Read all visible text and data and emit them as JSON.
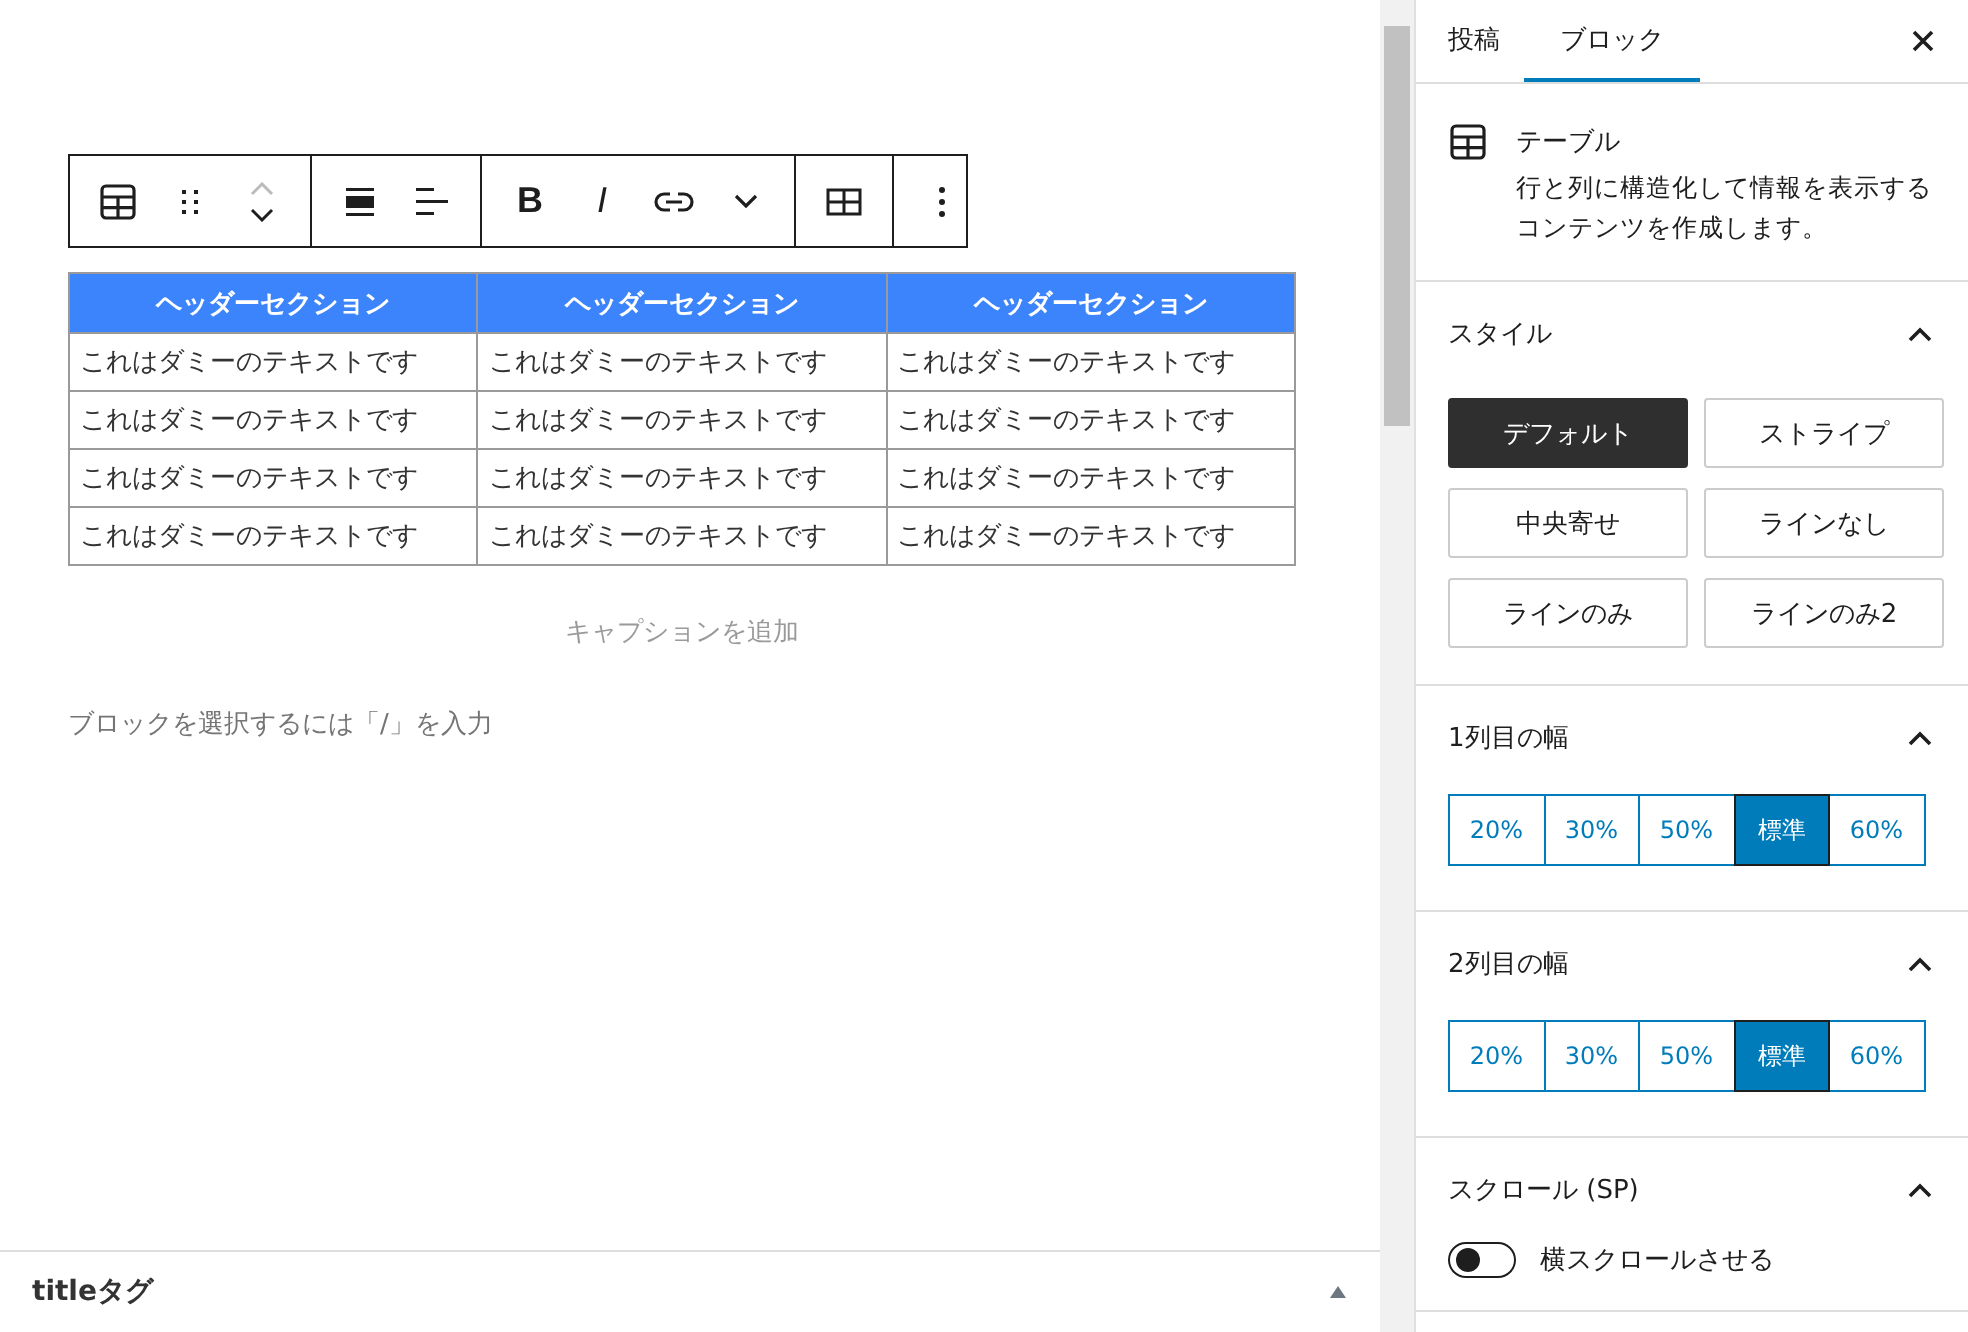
{
  "editor": {
    "toolbar": {
      "format_buttons": [
        "B",
        "I"
      ]
    },
    "table": {
      "header": [
        "ヘッダーセクション",
        "ヘッダーセクション",
        "ヘッダーセクション"
      ],
      "rows": [
        [
          "これはダミーのテキストです",
          "これはダミーのテキストです",
          "これはダミーのテキストです"
        ],
        [
          "これはダミーのテキストです",
          "これはダミーのテキストです",
          "これはダミーのテキストです"
        ],
        [
          "これはダミーのテキストです",
          "これはダミーのテキストです",
          "これはダミーのテキストです"
        ],
        [
          "これはダミーのテキストです",
          "これはダミーのテキストです",
          "これはダミーのテキストです"
        ]
      ],
      "caption_placeholder": "キャプションを追加"
    },
    "appender_placeholder": "ブロックを選択するには「/」を入力",
    "meta_box": {
      "title": "titleタグ",
      "expanded": false
    }
  },
  "sidebar": {
    "tabs": [
      {
        "label": "投稿",
        "selected": false
      },
      {
        "label": "ブロック",
        "selected": true
      }
    ],
    "block": {
      "name": "テーブル",
      "description": "行と列に構造化して情報を表示するコンテンツを作成します。"
    },
    "panels": [
      {
        "kind": "styles",
        "title": "スタイル",
        "expanded": true,
        "options": [
          {
            "label": "デフォルト",
            "selected": true
          },
          {
            "label": "ストライプ",
            "selected": false
          },
          {
            "label": "中央寄せ",
            "selected": false
          },
          {
            "label": "ラインなし",
            "selected": false
          },
          {
            "label": "ラインのみ",
            "selected": false
          },
          {
            "label": "ラインのみ2",
            "selected": false
          }
        ]
      },
      {
        "kind": "widths",
        "title": "1列目の幅",
        "expanded": true,
        "options": [
          {
            "label": "20%",
            "selected": false
          },
          {
            "label": "30%",
            "selected": false
          },
          {
            "label": "50%",
            "selected": false
          },
          {
            "label": "標準",
            "selected": true
          },
          {
            "label": "60%",
            "selected": false
          }
        ]
      },
      {
        "kind": "widths",
        "title": "2列目の幅",
        "expanded": true,
        "options": [
          {
            "label": "20%",
            "selected": false
          },
          {
            "label": "30%",
            "selected": false
          },
          {
            "label": "50%",
            "selected": false
          },
          {
            "label": "標準",
            "selected": true
          },
          {
            "label": "60%",
            "selected": false
          }
        ]
      },
      {
        "kind": "toggle",
        "title": "スクロール (SP)",
        "expanded": true,
        "toggle": {
          "label": "横スクロールさせる",
          "on": false
        }
      }
    ]
  }
}
